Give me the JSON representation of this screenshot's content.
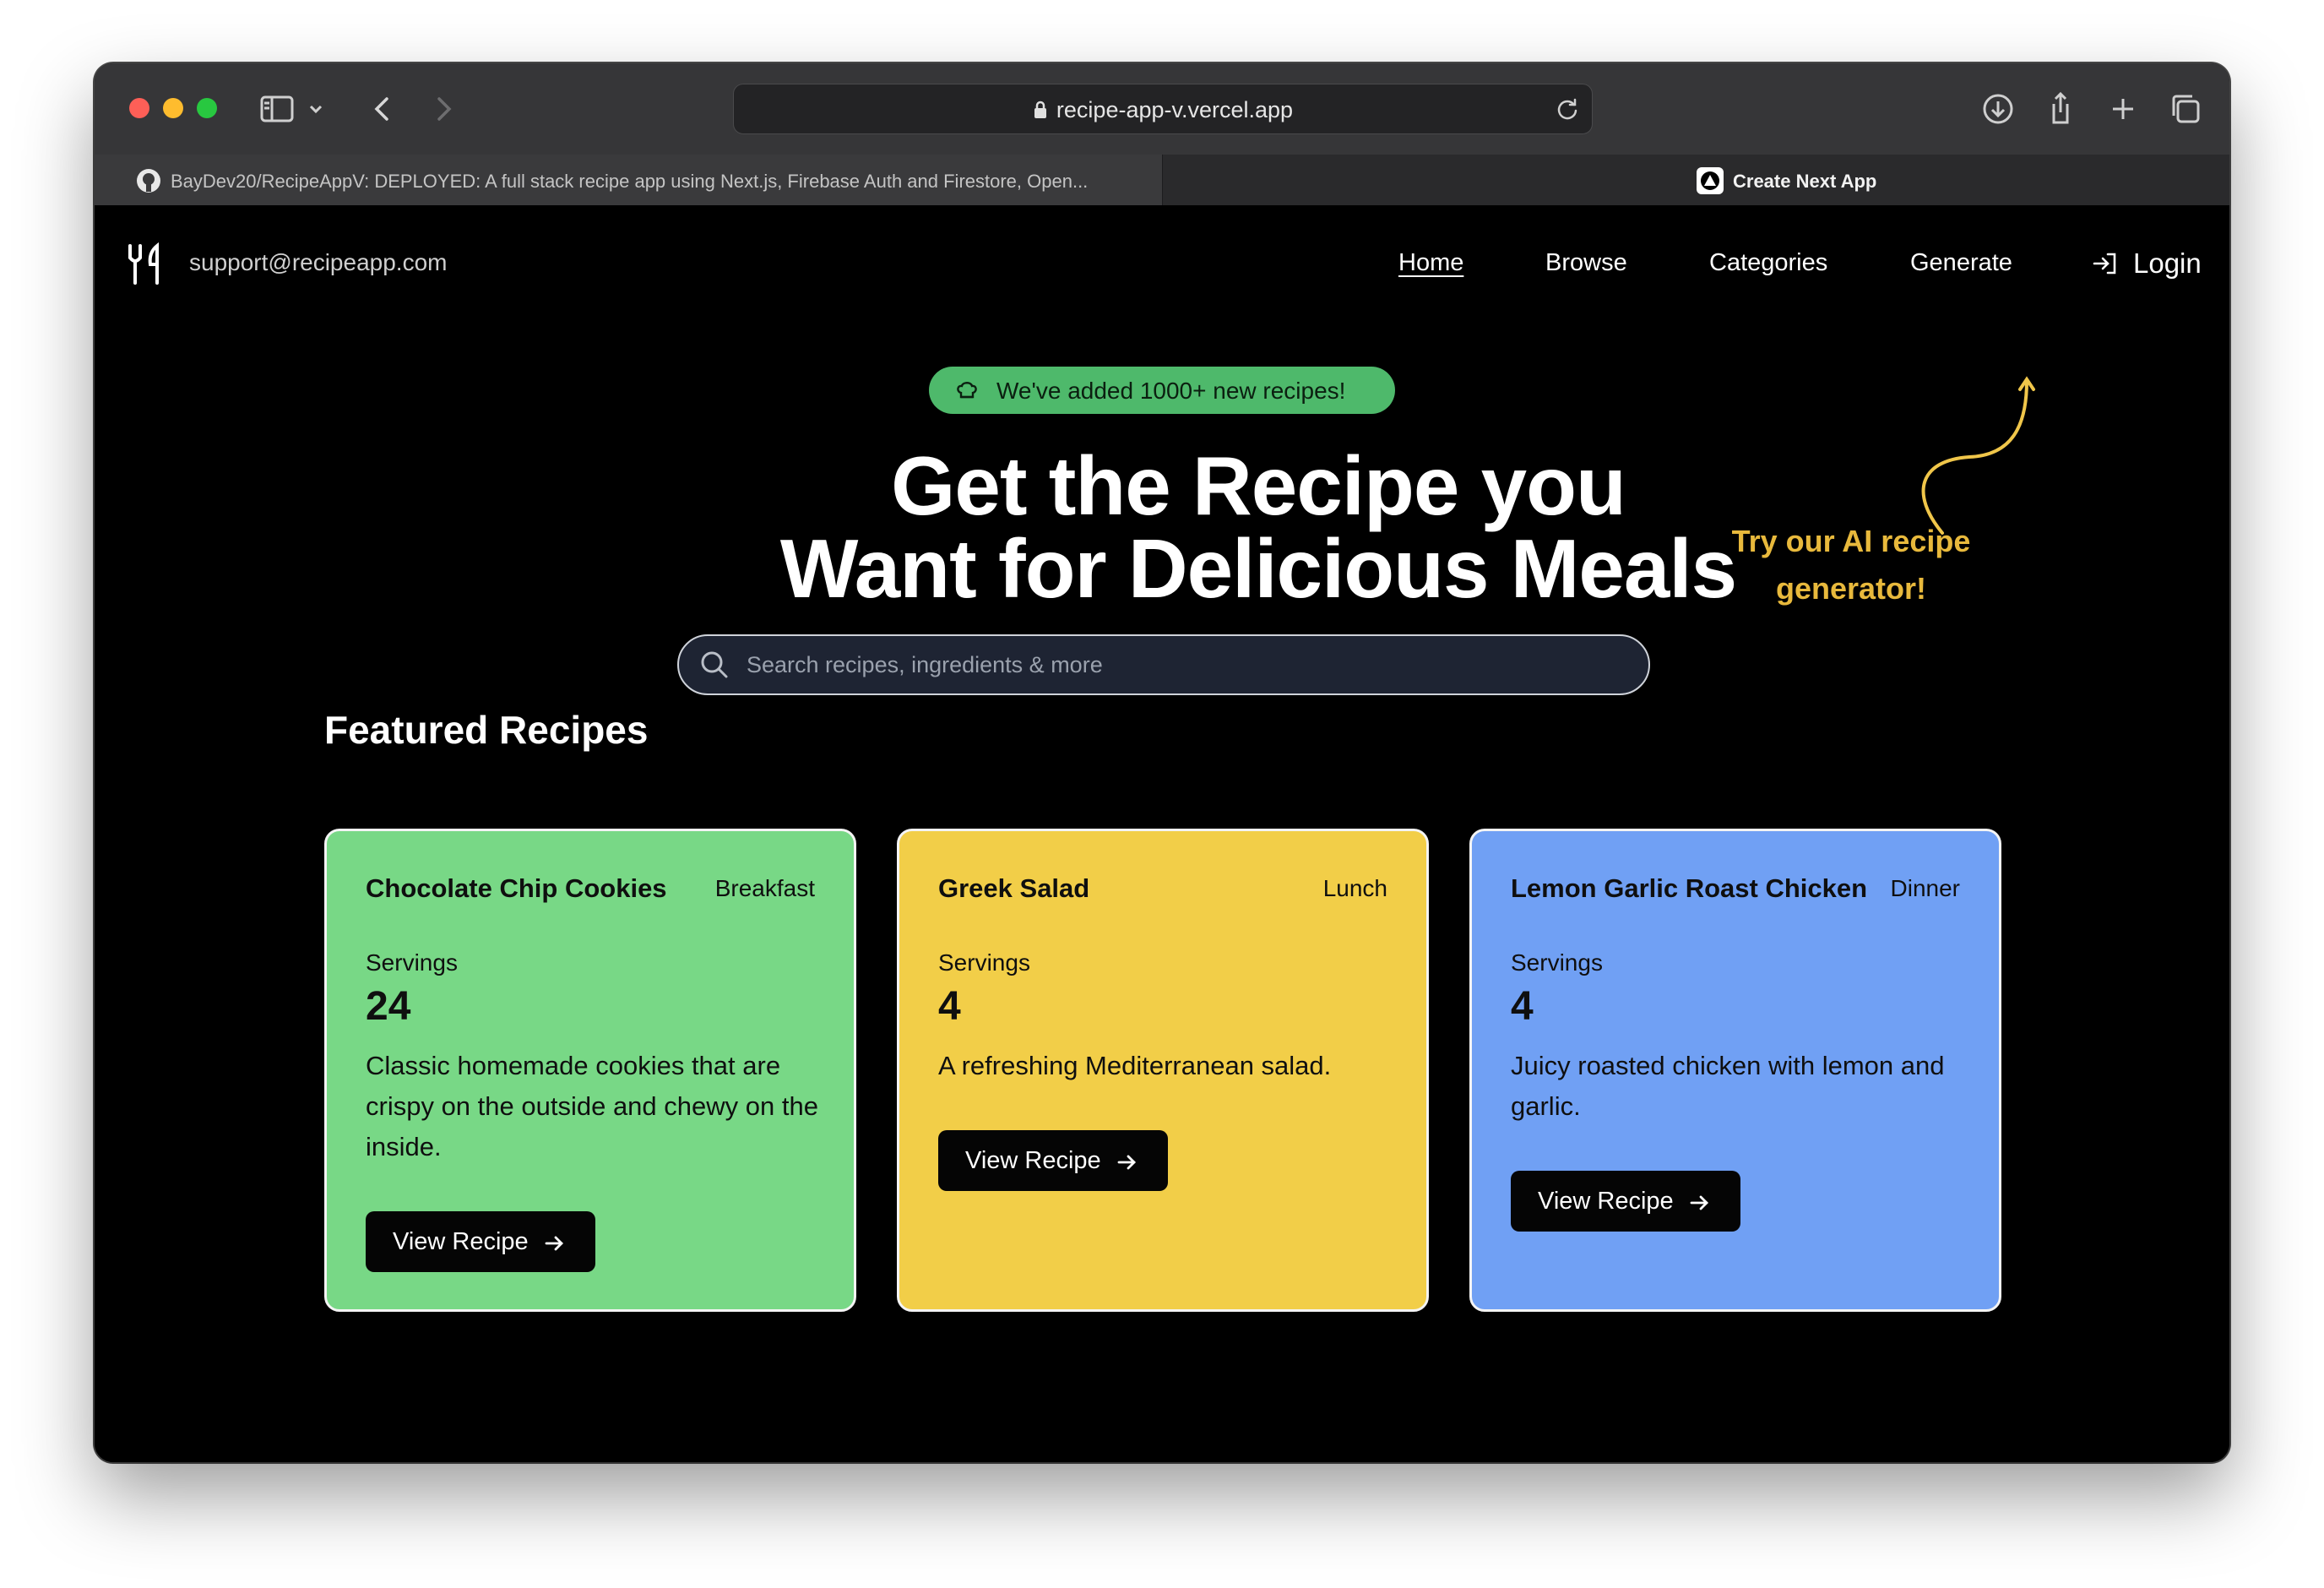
{
  "browser": {
    "url": "recipe-app-v.vercel.app",
    "tabs": [
      {
        "label": "BayDev20/RecipeAppV: DEPLOYED: A full stack recipe app using Next.js, Firebase Auth and Firestore, Open..."
      },
      {
        "label": "Create Next App"
      }
    ]
  },
  "header": {
    "email": "support@recipeapp.com",
    "nav": [
      "Home",
      "Browse",
      "Categories",
      "Generate"
    ],
    "login": "Login"
  },
  "hero": {
    "badge": "We've added 1000+ new recipes!",
    "title_line1": "Get the Recipe you",
    "title_line2": "Want for Delicious Meals",
    "search_placeholder": "Search recipes, ingredients & more",
    "callout_line1": "Try our AI recipe",
    "callout_line2": "generator!"
  },
  "featured": {
    "heading": "Featured Recipes",
    "cards": [
      {
        "title": "Chocolate Chip Cookies",
        "category": "Breakfast",
        "servings_label": "Servings",
        "servings": "24",
        "description": "Classic homemade cookies that are crispy on the outside and chewy on the inside.",
        "button": "View Recipe",
        "color": "#78d886"
      },
      {
        "title": "Greek Salad",
        "category": "Lunch",
        "servings_label": "Servings",
        "servings": "4",
        "description": "A refreshing Mediterranean salad.",
        "button": "View Recipe",
        "color": "#f2ce48"
      },
      {
        "title": "Lemon Garlic Roast Chicken",
        "category": "Dinner",
        "servings_label": "Servings",
        "servings": "4",
        "description": "Juicy roasted chicken with lemon and garlic.",
        "button": "View Recipe",
        "color": "#70a0f4"
      }
    ]
  },
  "colors": {
    "badge_green": "#4eb96b",
    "callout_yellow": "#e8b93c",
    "page_background": "#000000"
  }
}
